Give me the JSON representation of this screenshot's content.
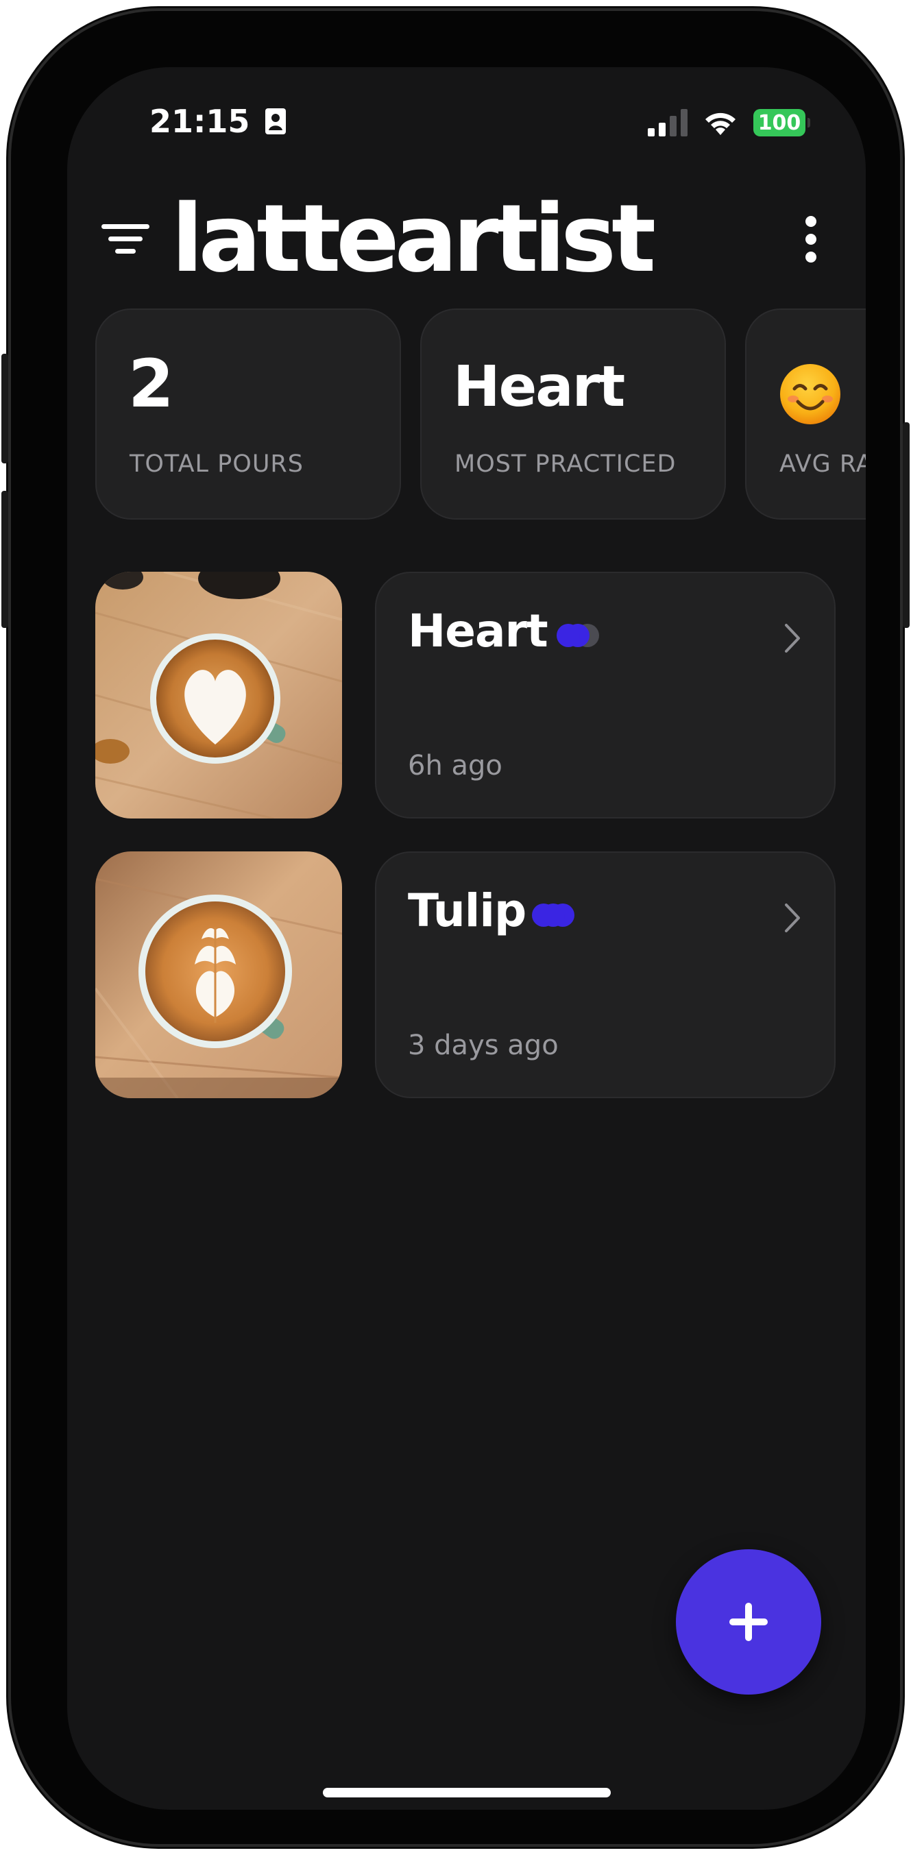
{
  "status_bar": {
    "time": "21:15",
    "battery": "100",
    "battery_color": "#35c759"
  },
  "header": {
    "title": "latteartist",
    "menu_icon": "filter-menu-icon",
    "more_icon": "more-vertical-icon"
  },
  "stats": [
    {
      "value": "2",
      "label": "TOTAL POURS"
    },
    {
      "value": "Heart",
      "label": "MOST PRACTICED"
    },
    {
      "value": "😊",
      "label": "AVG RA"
    }
  ],
  "pours": [
    {
      "name": "Heart",
      "time": "6h ago",
      "rating": 2,
      "rating_max": 3,
      "photo": "latte-heart-photo"
    },
    {
      "name": "Tulip",
      "time": "3 days ago",
      "rating": 2,
      "rating_max": 2,
      "photo": "latte-tulip-photo"
    }
  ],
  "fab": {
    "icon": "plus-icon"
  },
  "colors": {
    "accent": "#4a33e0",
    "background": "#151516",
    "card": "#212122",
    "muted_text": "#9a9a9f"
  }
}
